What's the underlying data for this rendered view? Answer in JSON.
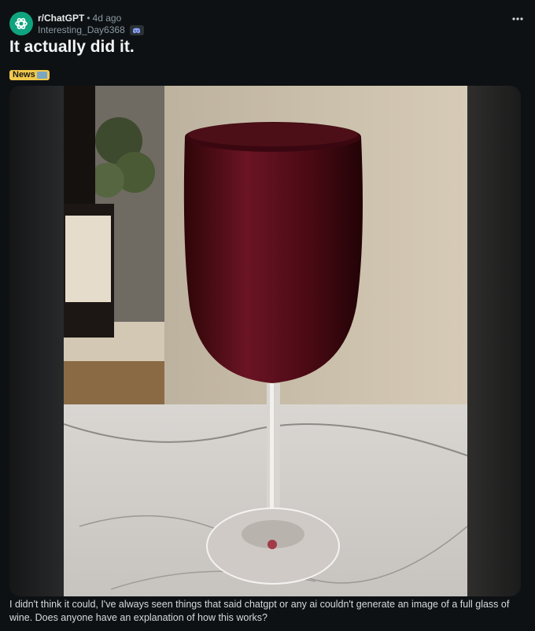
{
  "post": {
    "subreddit": "r/ChatGPT",
    "separator": "•",
    "age": "4d ago",
    "author": "Interesting_Day6368",
    "title": "It actually did it.",
    "flair": "News",
    "body": "I didn't think it could, I've always seen things that said chatgpt or any ai couldn't generate an image of a full glass of wine. Does anyone have an explanation of how this works?"
  },
  "icons": {
    "avatar": "openai-logo-icon",
    "badge": "discord-icon",
    "menu": "more-options-icon",
    "flair_emoji": "newspaper-emoji-icon"
  },
  "colors": {
    "background": "#0e1113",
    "avatar_bg": "#10a37f",
    "flair_bg": "#f2c94c",
    "wine": "#5a0f1a"
  }
}
